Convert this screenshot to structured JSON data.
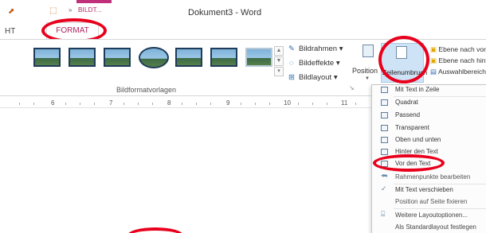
{
  "titlebar": {
    "context_tab_label": "BILDT...",
    "document_title": "Dokument3 - Word"
  },
  "tabs": {
    "partial_tab": "HT",
    "active_tab": "FORMAT"
  },
  "ribbon": {
    "styles_group_label": "Bildformatvorlagen",
    "bildrahmen": "Bildrahmen",
    "bildeffekte": "Bildeffekte",
    "bildlayout": "Bildlayout",
    "position_label": "Position",
    "wrap_label": "Zeilenumbruch",
    "ebene_nach_vorne": "Ebene nach vorne",
    "ebene_nach_hinten": "Ebene nach hinten",
    "auswahlbereich": "Auswahlbereich"
  },
  "ruler": {
    "numbers": [
      "6",
      "7",
      "8",
      "9",
      "10",
      "11"
    ]
  },
  "wrap_menu": {
    "items": [
      {
        "label": "Mit Text in Zeile",
        "icon": "inline-wrap-icon"
      },
      {
        "label": "Quadrat",
        "icon": "square-wrap-icon"
      },
      {
        "label": "Passend",
        "icon": "tight-wrap-icon"
      },
      {
        "label": "Transparent",
        "icon": "through-wrap-icon"
      },
      {
        "label": "Oben und unten",
        "icon": "top-bottom-wrap-icon"
      },
      {
        "label": "Hinter den Text",
        "icon": "behind-text-icon"
      },
      {
        "label": "Vor den Text",
        "icon": "in-front-text-icon"
      },
      {
        "label": "Rahmenpunkte bearbeiten",
        "icon": "edit-wrap-points-icon"
      },
      {
        "label": "Mit Text verschieben",
        "icon": "check-icon"
      },
      {
        "label": "Position auf Seite fixieren",
        "icon": ""
      },
      {
        "label": "Weitere Layoutoptionen...",
        "icon": "layout-options-icon"
      },
      {
        "label": "Als Standardlayout festlegen",
        "icon": ""
      }
    ]
  },
  "colors": {
    "accent": "#b0225c",
    "annotation": "#e8001c",
    "selected": "#cfe3f6"
  }
}
